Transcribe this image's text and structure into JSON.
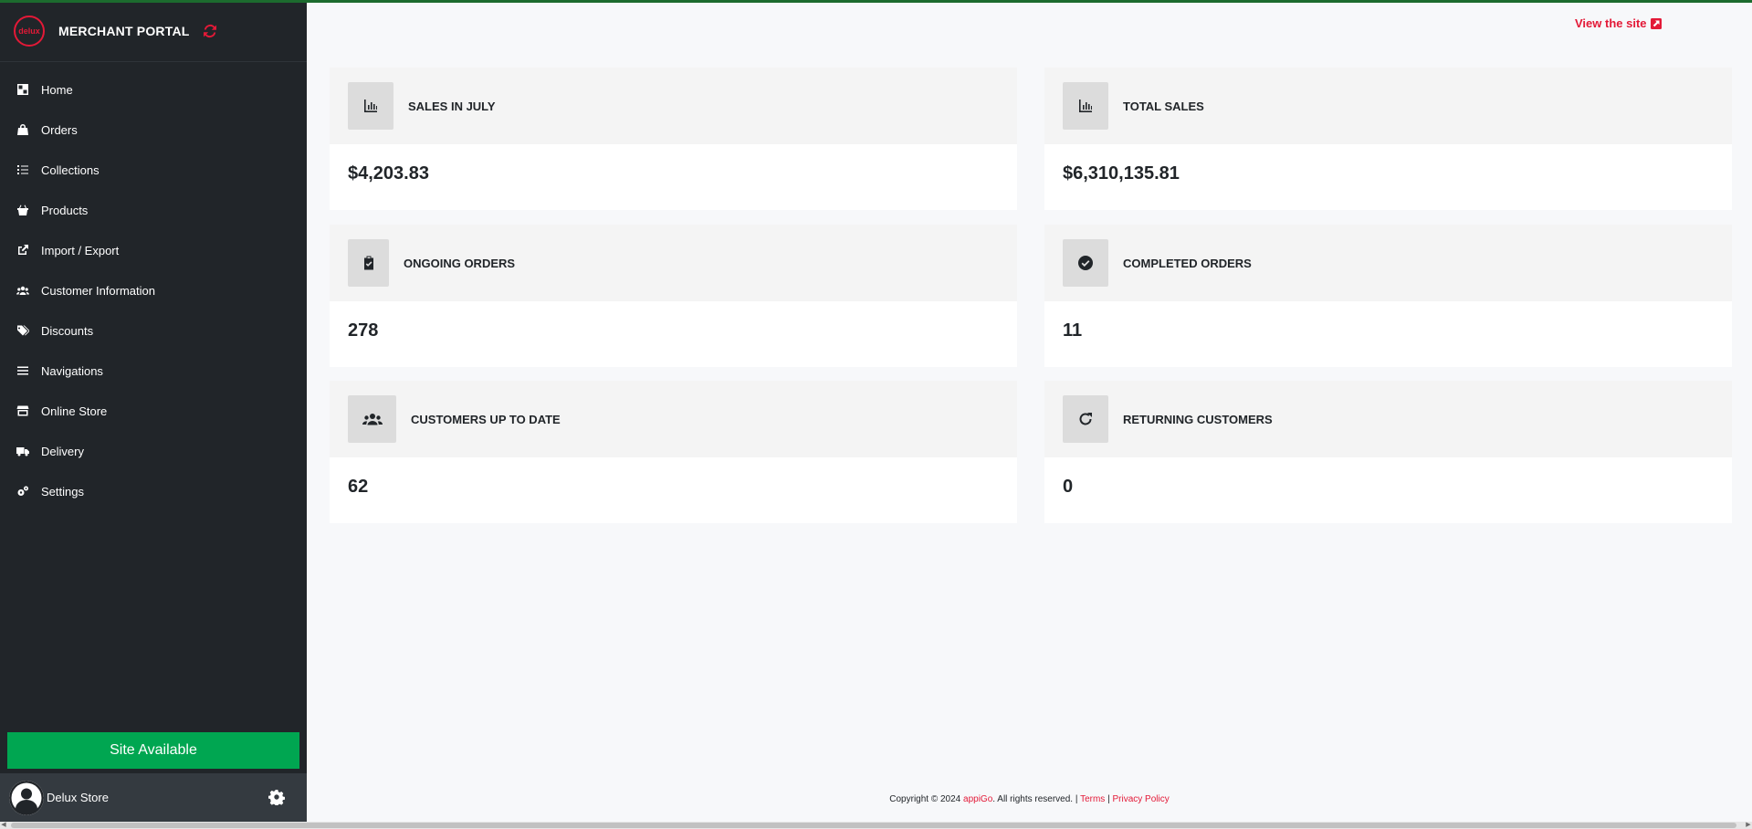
{
  "brand": {
    "logo_text": "delux",
    "title": "MERCHANT PORTAL"
  },
  "nav": [
    {
      "label": "Home",
      "icon": "home-icon"
    },
    {
      "label": "Orders",
      "icon": "bag-icon"
    },
    {
      "label": "Collections",
      "icon": "list-icon"
    },
    {
      "label": "Products",
      "icon": "basket-icon"
    },
    {
      "label": "Import / Export",
      "icon": "external-link-icon"
    },
    {
      "label": "Customer Information",
      "icon": "users-icon"
    },
    {
      "label": "Discounts",
      "icon": "tags-icon"
    },
    {
      "label": "Navigations",
      "icon": "menu-icon"
    },
    {
      "label": "Online Store",
      "icon": "store-icon"
    },
    {
      "label": "Delivery",
      "icon": "truck-icon"
    },
    {
      "label": "Settings",
      "icon": "gears-icon"
    }
  ],
  "site_status": "Site Available",
  "user": {
    "name": "Delux Store"
  },
  "header": {
    "view_site": "View the site"
  },
  "cards": [
    {
      "title": "SALES IN JULY",
      "value": "$4,203.83",
      "icon": "chart-icon"
    },
    {
      "title": "TOTAL SALES",
      "value": "$6,310,135.81",
      "icon": "chart-icon"
    },
    {
      "title": "ONGOING ORDERS",
      "value": "278",
      "icon": "clipboard-check-icon"
    },
    {
      "title": "COMPLETED ORDERS",
      "value": "11",
      "icon": "check-circle-icon"
    },
    {
      "title": "CUSTOMERS UP TO DATE",
      "value": "62",
      "icon": "users-icon"
    },
    {
      "title": "RETURNING CUSTOMERS",
      "value": "0",
      "icon": "redo-icon"
    }
  ],
  "footer": {
    "copyright": "Copyright © 2024",
    "company": "appiGo",
    "rights": ". All rights reserved. |",
    "terms": "Terms",
    "separator": "|",
    "privacy": "Privacy Policy"
  },
  "colors": {
    "sidebar": "#212529",
    "accent": "#e31937",
    "status": "#00a651",
    "top_bar": "#1c6b2e"
  }
}
